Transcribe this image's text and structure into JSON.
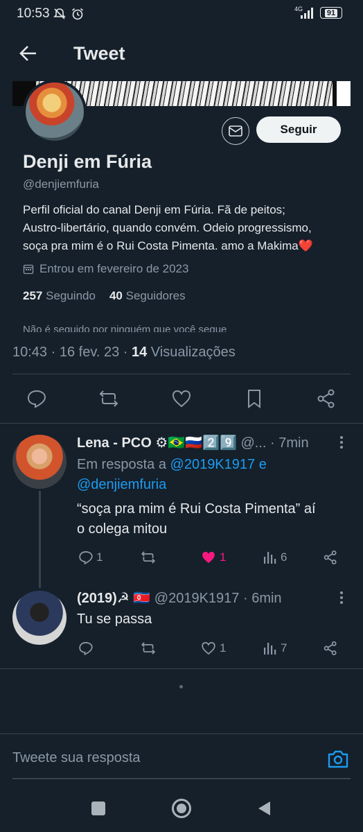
{
  "status_bar": {
    "time": "10:53",
    "network": "4G",
    "battery": "91"
  },
  "header": {
    "title": "Tweet"
  },
  "profile": {
    "name": "Denji em Fúria",
    "handle": "@denjiemfuria",
    "follow_label": "Seguir",
    "bio_line1": "Perfil oficial do canal Denji em Fúria. Fã de peitos;",
    "bio_line2": "Austro-libertário, quando convém. Odeio progressismo,",
    "bio_line3": "soça pra mim é o Rui Costa Pimenta.  amo a Makima",
    "bio_emoji": "❤️",
    "joined": "Entrou em fevereiro de 2023",
    "following_count": "257",
    "following_label": "Seguindo",
    "followers_count": "40",
    "followers_label": "Seguidores",
    "followed_by": "Não é seguido por ninguém que você segue"
  },
  "tweet_meta": {
    "time": "10:43",
    "sep1": " · ",
    "date": "16 fev. 23",
    "sep2": " · ",
    "views": "14",
    "views_label": "Visualizações"
  },
  "replies": [
    {
      "name": "Lena - PCO",
      "name_badges": "⚙🇧🇷🇷🇺2️⃣9️⃣",
      "handle": "@...",
      "time": "· 7min",
      "reply_prefix": "Em resposta a",
      "reply_to1": "@2019K1917",
      "reply_and": "e",
      "reply_to2": "@denjiemfuria",
      "text_line1": "“soça pra mim é Rui Costa Pimenta” aí",
      "text_line2": "o colega mitou",
      "replies_count": "1",
      "likes_count": "1",
      "views_count": "6"
    },
    {
      "name": "(2019)☭",
      "name_badges": "🇰🇵",
      "handle": "@2019K1917",
      "time": "· 6min",
      "text_line1": "Tu se passa",
      "likes_count": "1",
      "views_count": "7"
    }
  ],
  "reply_input": {
    "placeholder": "Tweete sua resposta"
  },
  "colors": {
    "background": "#15202b",
    "accent": "#1d9bf0",
    "like_active": "#f91880",
    "muted": "#8b98a5",
    "divider": "#38444d"
  }
}
